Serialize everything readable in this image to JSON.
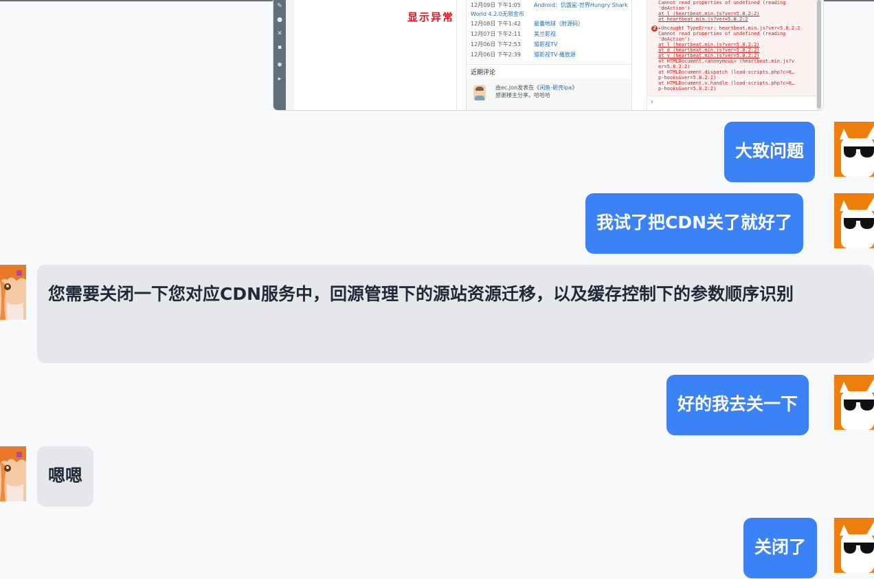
{
  "screenshot": {
    "stamp": "显示异常",
    "subtitle": "World 4.2.0无限金币",
    "rows": [
      {
        "date": "12月09日 下午1:05",
        "link": "Android：饥饿鲨-世界Hungry Shark"
      },
      {
        "date": "12月08日 下午1:42",
        "link": "最囊地球（附源码）"
      },
      {
        "date": "12月07日 下午2:11",
        "link": "美兰影视"
      },
      {
        "date": "12月06日 下午2:53",
        "link": "猫影视TV"
      },
      {
        "date": "12月06日 下午2:39",
        "link": "猫影视TV-播放源"
      }
    ],
    "recent_comments_title": "近期评论",
    "comment_line1_prefix": "由ec.Jon发表在《",
    "comment_link": "闲鱼-砸壳ipa",
    "comment_line1_suffix": "》",
    "comment_line2": "感谢楼主分享。哈哈哈",
    "console_lines": [
      "Cannot read properties of undefined (reading",
      "'doAction')",
      "    at l (heartbeat.min.js?ver=5.8.2:2)",
      "    at heartbeat.min.js?ver=5.8.2:2",
      "▸Uncaught TypeError:  heartbeat.min.js?ver=5.8.2:2",
      "Cannot read properties of undefined (reading",
      "'doAction')",
      "    at l (heartbeat.min.js?ver=5.8.2:2)",
      "    at d (heartbeat.min.js?ver=5.8.2:2)",
      "    at v (heartbeat.min.js?ver=5.8.2:2)",
      "    at HTMLDocument.<anonymous> (heartbeat.min.js?v",
      "er=5.8.2:2)",
      "    at HTMLDocument.dispatch (load-scripts.php?c=0…",
      "p-hooks&ver=5.8.2:2)",
      "    at HTMLDocument.v.handle (load-scripts.php?c=0…",
      "p-hooks&ver=5.8.2:2)"
    ],
    "error_count": "2",
    "console_prompt": "›"
  },
  "messages": {
    "m1": "大致问题",
    "m2": "我试了把CDN关了就好了",
    "m3": "您需要关闭一下您对应CDN服务中，回源管理下的源站资源迁移，以及缓存控制下的参数顺序识别",
    "m4": "好的我去关一下",
    "m5": "嗯嗯",
    "m6": "关闭了"
  },
  "colors": {
    "user_bubble": "#3b82f6",
    "agent_bubble": "#e5e7eb",
    "background": "#f8f9fb",
    "cat_avatar_bg": "#f07e0c"
  },
  "icons": {
    "user_avatar": "cat-with-sunglasses",
    "agent_avatar": "anime-girl"
  }
}
